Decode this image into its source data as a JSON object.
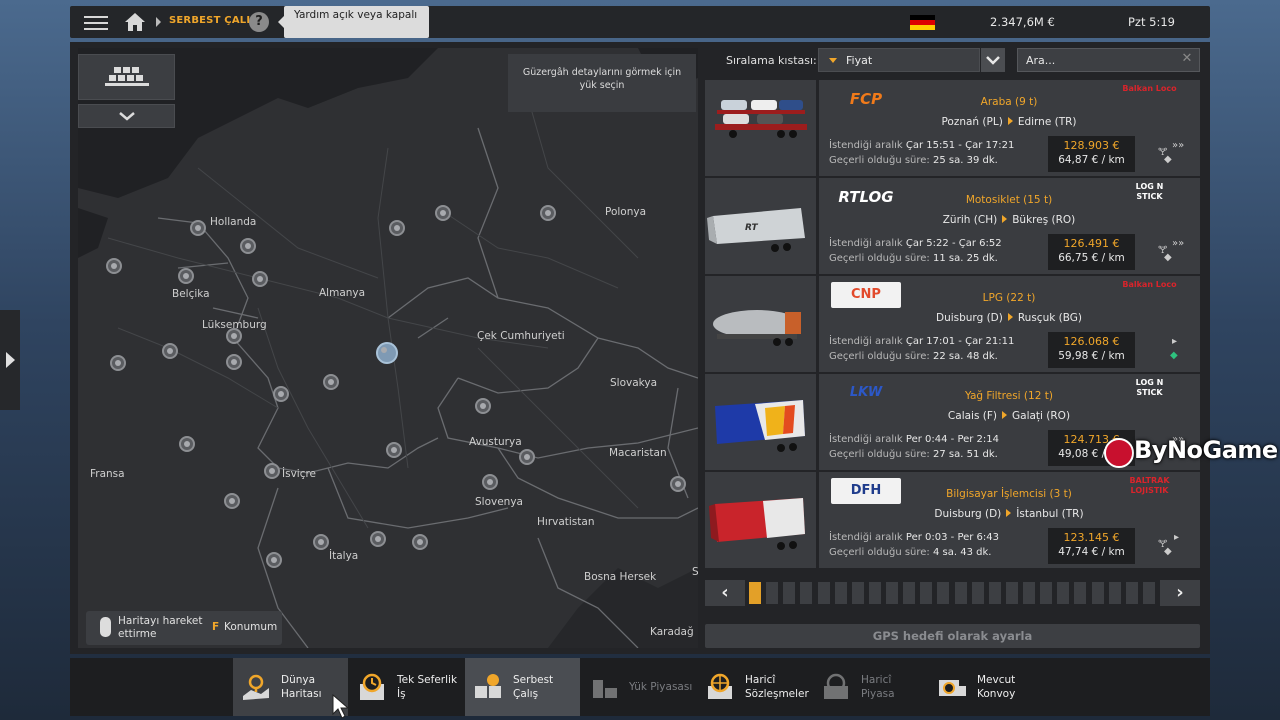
{
  "topbar": {
    "breadcrumb": "SERBEST ÇALIŞ",
    "help_label": "?",
    "tooltip": "Yardım açık veya kapalı",
    "money": "2.347,6M  €",
    "time": "Pzt 5:19",
    "icons": [
      "menu-icon",
      "home-icon",
      "help-icon",
      "flag-germany-icon"
    ]
  },
  "map": {
    "route_hint": "Güzergâh detaylarını görmek için yük seçin",
    "labels": {
      "hollanda": "Hollanda",
      "belcika": "Belçika",
      "luksemburg": "Lüksemburg",
      "almanya": "Almanya",
      "polonya": "Polonya",
      "cek": "Çek Cumhuriyeti",
      "slovakya": "Slovakya",
      "avusturya": "Avusturya",
      "macaristan": "Macaristan",
      "fransa": "Fransa",
      "isvicre": "İsviçre",
      "slovenya": "Slovenya",
      "hirvatistan": "Hırvatistan",
      "italya": "İtalya",
      "bosna": "Bosna Hersek",
      "karadag": "Karadağ",
      "s": "S"
    },
    "controls": {
      "move_label": "Haritayı hareket ettirme",
      "key": "F",
      "location_label": "Konumum"
    }
  },
  "sort": {
    "label": "Sıralama kıstası:",
    "value": "Fiyat",
    "search_value": "Ara..."
  },
  "jobs": [
    {
      "company": "FCP",
      "cargo": "Araba (9 t)",
      "from": "Poznań (PL)",
      "to": "Edirne (TR)",
      "range_label": "İstendiği aralık",
      "range": "Çar 15:51 - Çar 17:21",
      "valid_label": "Geçerli olduğu süre:",
      "valid": "25 sa. 39 dk.",
      "price": "128.903 €",
      "per_km": "64,87 € / km",
      "recipient": "Balkan Loco",
      "trailer": "car-transporter"
    },
    {
      "company": "RTLOG",
      "cargo": "Motosiklet (15 t)",
      "from": "Zürih (CH)",
      "to": "Bükreş (RO)",
      "range_label": "İstendiği aralık",
      "range": "Çar 5:22 - Çar 6:52",
      "valid_label": "Geçerli olduğu süre:",
      "valid": "11 sa. 25 dk.",
      "price": "126.491 €",
      "per_km": "66,75 € / km",
      "recipient": "LOG N STICK",
      "trailer": "curtainsider"
    },
    {
      "company": "CNP",
      "cargo": "LPG (22 t)",
      "from": "Duisburg (D)",
      "to": "Rusçuk (BG)",
      "range_label": "İstendiği aralık",
      "range": "Çar 17:01 - Çar 21:11",
      "valid_label": "Geçerli olduğu süre:",
      "valid": "22 sa. 48 dk.",
      "price": "126.068 €",
      "per_km": "59,98 € / km",
      "recipient": "Balkan Loco",
      "trailer": "tanker"
    },
    {
      "company": "LKW",
      "cargo": "Yağ Filtresi (12 t)",
      "from": "Calais (F)",
      "to": "Galați (RO)",
      "range_label": "İstendiği aralık",
      "range": "Per 0:44 - Per 2:14",
      "valid_label": "Geçerli olduğu süre:",
      "valid": "27 sa. 51 dk.",
      "price": "124.713 €",
      "per_km": "49,08 € / km",
      "recipient": "LOG N STICK",
      "trailer": "box"
    },
    {
      "company": "DFH",
      "cargo": "Bilgisayar İşlemcisi (3 t)",
      "from": "Duisburg (D)",
      "to": "İstanbul (TR)",
      "range_label": "İstendiği aralık",
      "range": "Per 0:03 - Per 6:43",
      "valid_label": "Geçerli olduğu süre:",
      "valid": "4 sa. 43 dk.",
      "price": "123.145 €",
      "per_km": "47,74 € / km",
      "recipient": "BALTRAK LOJISTIK",
      "trailer": "refrigerated"
    }
  ],
  "pager": {
    "pages": 24,
    "current": 1
  },
  "gps_button": "GPS hedefi olarak ayarla",
  "nav": [
    {
      "label1": "Dünya",
      "label2": "Haritası",
      "icon": "world-map-icon"
    },
    {
      "label1": "Tek Seferlik",
      "label2": "İş",
      "icon": "clock-icon"
    },
    {
      "label1": "Serbest",
      "label2": "Çalış",
      "icon": "freight-market-icon"
    },
    {
      "label1": "Yük Piyasası",
      "label2": "",
      "icon": "cargo-market-icon"
    },
    {
      "label1": "Haricî",
      "label2": "Sözleşmeler",
      "icon": "globe-contracts-icon"
    },
    {
      "label1": "Haricî",
      "label2": "Piyasa",
      "icon": "external-market-icon"
    },
    {
      "label1": "Mevcut",
      "label2": "Konvoy",
      "icon": "convoy-icon"
    }
  ],
  "watermark": "ByNoGame",
  "colors": {
    "accent": "#f0a62a",
    "panel": "#3a3c40",
    "background": "#232427"
  }
}
